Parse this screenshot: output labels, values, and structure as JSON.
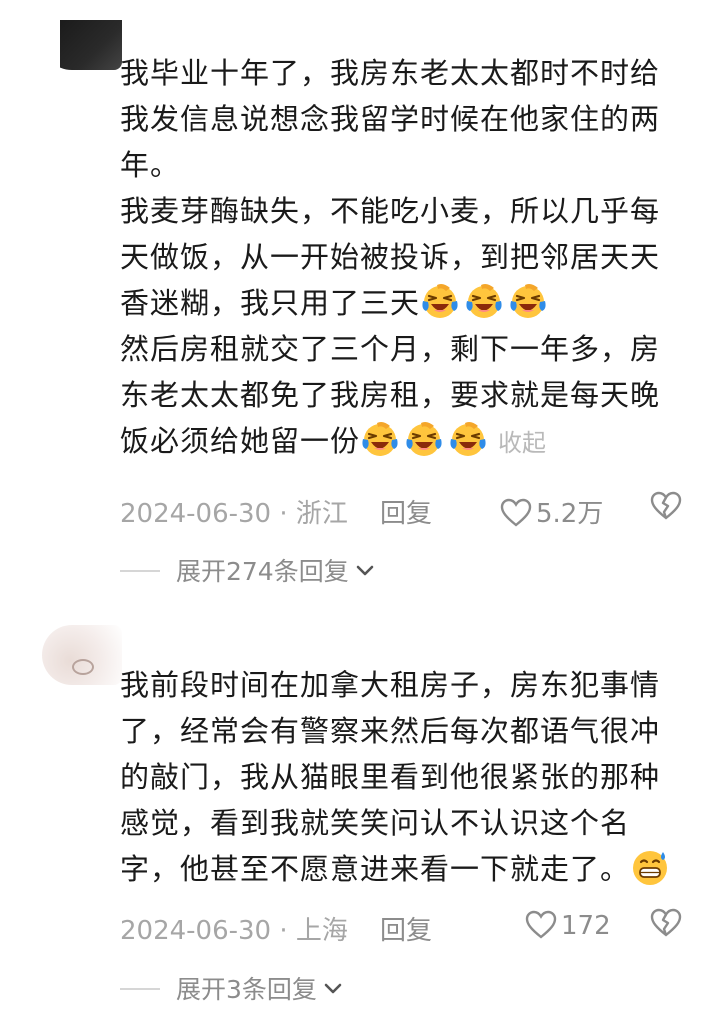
{
  "comments": [
    {
      "paragraphs": [
        "我毕业十年了，我房东老太太都时不时给我发信息说想念我留学时候在他家住的两年。",
        "我麦芽酶缺失，不能吃小麦，所以几乎每天做饭，从一开始被投诉，到把邻居天天香迷糊，我只用了三天",
        "然后房租就交了三个月，剩下一年多，房东老太太都免了我房租，要求就是每天晚饭必须给她留一份"
      ],
      "collapse": "收起",
      "date": "2024-06-30 · 浙江",
      "reply": "回复",
      "likes": "5.2万",
      "expand": "展开274条回复"
    },
    {
      "paragraphs": [
        "我前段时间在加拿大租房子，房东犯事情了，经常会有警察来然后每次都语气很冲的敲门，我从猫眼里看到他很紧张的那种感觉，看到我就笑笑问认不认识这个名字，他甚至不愿意进来看一下就走了。"
      ],
      "date": "2024-06-30 · 上海",
      "reply": "回复",
      "likes": "172",
      "expand": "展开3条回复"
    }
  ],
  "icons": {
    "laugh_cry": "laugh-cry-emoji",
    "sweat_grin": "sweat-grin-emoji",
    "like": "heart-outline-icon",
    "dislike": "broken-heart-icon",
    "expand": "chevron-down-icon"
  },
  "colors": {
    "emoji_yellow": "#ffc53d",
    "tear_blue": "#2f8ce8",
    "text": "#1a1a1a",
    "muted": "#a6a6a6"
  }
}
